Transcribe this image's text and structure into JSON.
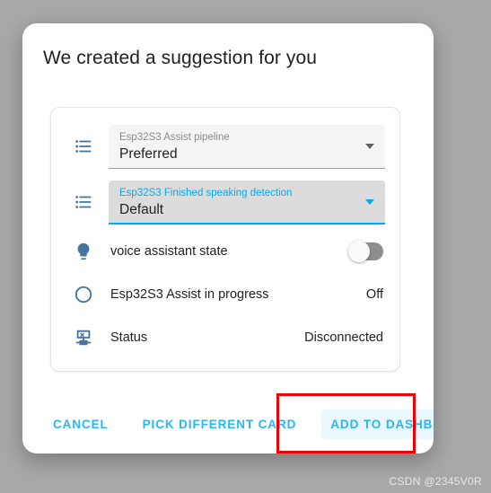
{
  "backdrop_color": "#a8a8a8",
  "accent_color": "#03a9f4",
  "link_color": "#29b6f6",
  "icon_color": "#44739e",
  "annotation_color": "#ef0000",
  "dialog": {
    "title": "We created a suggestion for you"
  },
  "preview_card": {
    "selects": [
      {
        "icon": "format-list-bulleted-icon",
        "label": "Esp32S3 Assist pipeline",
        "value": "Preferred",
        "state": "idle",
        "caret": "chevron-down-icon"
      },
      {
        "icon": "format-list-bulleted-icon",
        "label": "Esp32S3 Finished speaking detection",
        "value": "Default",
        "state": "focused",
        "caret": "chevron-down-icon"
      }
    ],
    "entities": [
      {
        "icon": "lightbulb-icon",
        "label": "voice assistant state",
        "control": "toggle",
        "toggle_on": false
      },
      {
        "icon": "circle-outline-icon",
        "label": "Esp32S3 Assist in progress",
        "control": "text",
        "state": "Off"
      },
      {
        "icon": "lan-disconnect-icon",
        "label": "Status",
        "control": "text",
        "state": "Disconnected"
      }
    ]
  },
  "actions": {
    "cancel_label": "CANCEL",
    "pick_label": "PICK DIFFERENT CARD",
    "add_label": "ADD TO DASHBOARD"
  },
  "watermark": {
    "text": "CSDN @2345V0R"
  }
}
